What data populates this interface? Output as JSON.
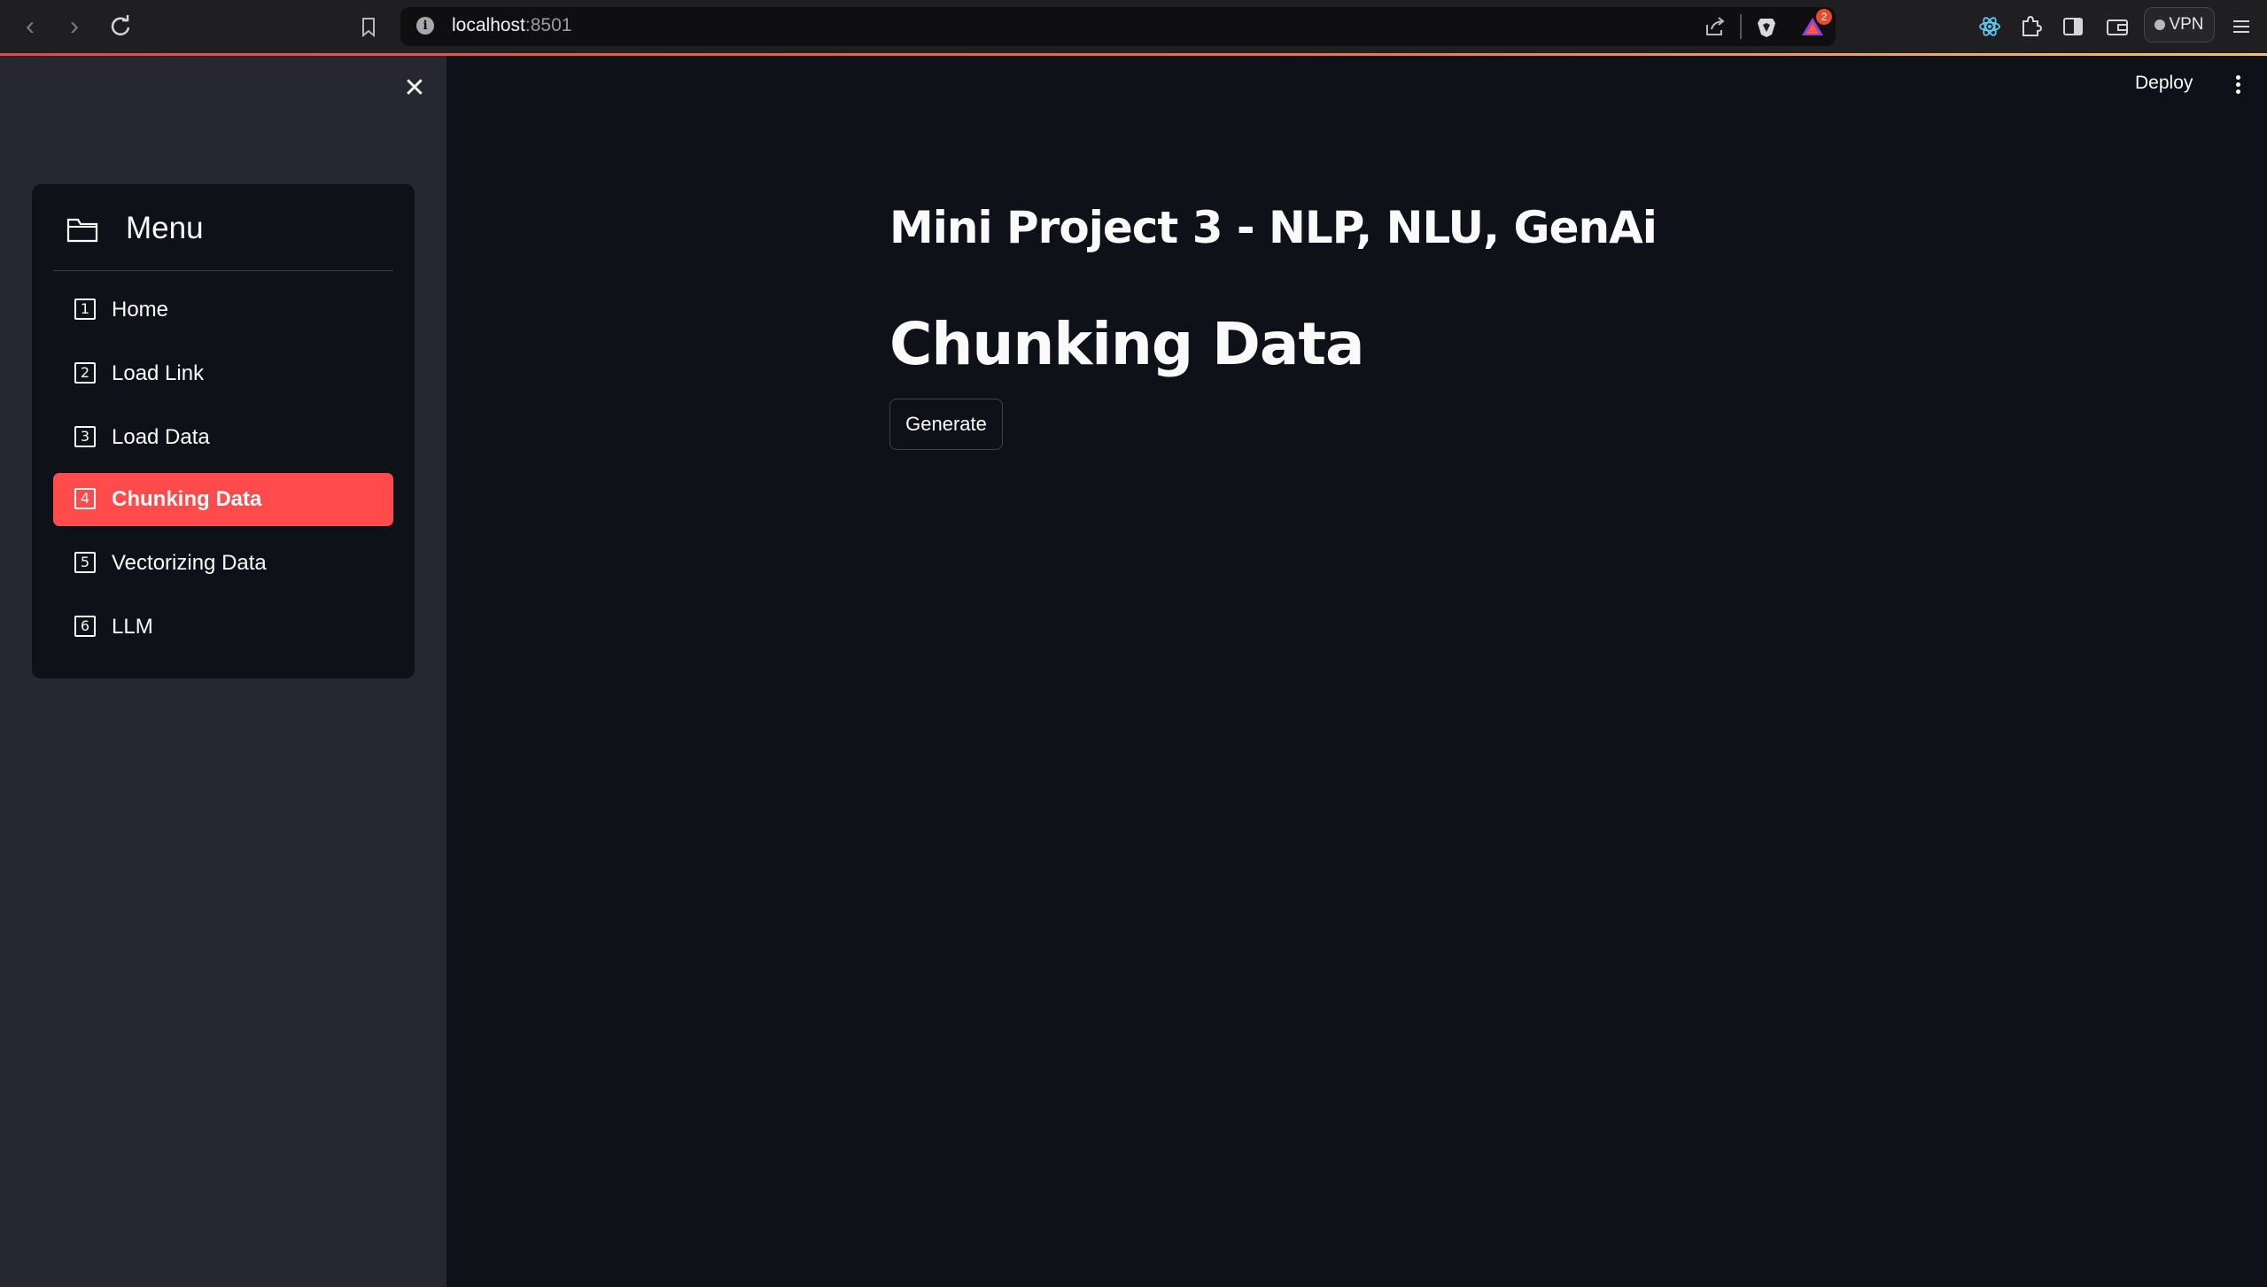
{
  "browser": {
    "url_host": "localhost",
    "url_port": ":8501",
    "notification_count": "2",
    "vpn_label": "VPN"
  },
  "sidebar": {
    "menu_title": "Menu",
    "items": [
      {
        "num": "1",
        "label": "Home",
        "selected": false
      },
      {
        "num": "2",
        "label": "Load Link",
        "selected": false
      },
      {
        "num": "3",
        "label": "Load Data",
        "selected": false
      },
      {
        "num": "4",
        "label": "Chunking Data",
        "selected": true
      },
      {
        "num": "5",
        "label": "Vectorizing Data",
        "selected": false
      },
      {
        "num": "6",
        "label": "LLM",
        "selected": false
      }
    ]
  },
  "header": {
    "deploy_label": "Deploy"
  },
  "main": {
    "app_title": "Mini Project 3 - NLP, NLU, GenAi",
    "page_title": "Chunking Data",
    "generate_label": "Generate"
  },
  "colors": {
    "accent": "#ff4b4b",
    "background": "#0e1117",
    "sidebar": "#262730"
  }
}
